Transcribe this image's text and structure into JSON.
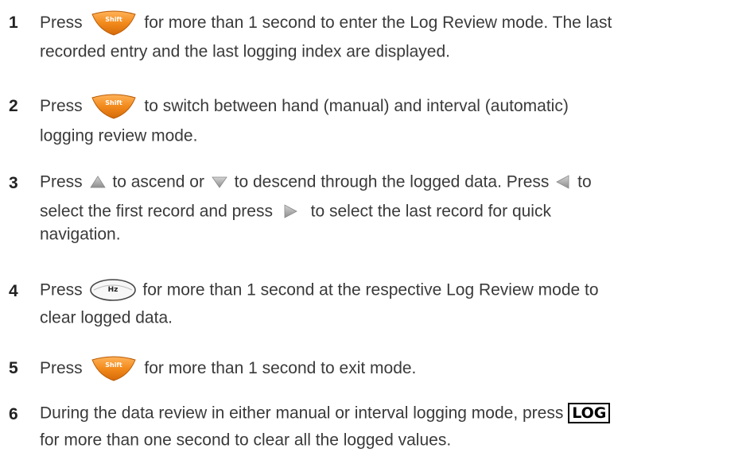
{
  "steps": [
    {
      "number": "1",
      "line1_a": "Press",
      "line1_b": "for more than 1 second to enter the Log Review mode. The last",
      "line2": "recorded entry and the last logging index are displayed.",
      "key_label": "Shift"
    },
    {
      "number": "2",
      "line1_a": "Press",
      "line1_b": "to switch between hand (manual) and interval (automatic)",
      "line2": "logging review mode.",
      "key_label": "Shift"
    },
    {
      "number": "3",
      "line1_a": "Press",
      "line1_b": "to ascend or",
      "line1_c": "to descend through the logged data. Press",
      "line1_d": "to",
      "line2_a": "select the first record and press",
      "line2_b": "to select the last record for quick",
      "line3": "navigation."
    },
    {
      "number": "4",
      "line1_a": "Press",
      "line1_b": "for more than 1 second at the respective Log Review mode to",
      "line2": "clear logged data.",
      "key_label": "Hz"
    },
    {
      "number": "5",
      "line1_a": "Press",
      "line1_b": "for more than 1 second to exit mode.",
      "key_label": "Shift"
    },
    {
      "number": "6",
      "line1_a": "During the data review in either manual or interval logging mode, press",
      "line2": "for more than one second to clear all the logged values.",
      "key_label": "LOG"
    }
  ],
  "colors": {
    "shift_key": "#f08a1e",
    "arrow_key": "#a9a9a9",
    "text": "#3a3a3a"
  },
  "icons": {
    "shift": "shift-key-icon",
    "up": "up-arrow-key-icon",
    "down": "down-arrow-key-icon",
    "left": "left-arrow-key-icon",
    "right": "right-arrow-key-icon",
    "hz": "hz-key-icon"
  }
}
